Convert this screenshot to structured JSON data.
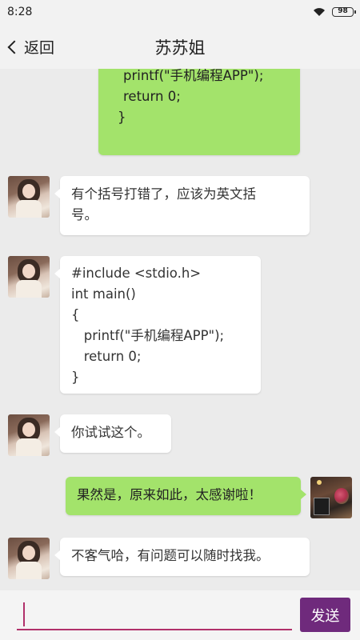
{
  "status_bar": {
    "time": "8:28",
    "battery": "98",
    "wifi_icon": "wifi-icon"
  },
  "header": {
    "back_label": "返回",
    "title": "苏苏姐"
  },
  "messages": [
    {
      "side": "right",
      "lines": [
        "printf(\"手机编程APP\");",
        "return 0;",
        "}"
      ]
    },
    {
      "side": "left",
      "lines": [
        "有个括号打错了，应该为英文括",
        "号。"
      ]
    },
    {
      "side": "left",
      "lines": [
        "#include <stdio.h>",
        "int main()",
        "{",
        "   printf(\"手机编程APP\");",
        "   return 0;",
        "}"
      ]
    },
    {
      "side": "left",
      "lines": [
        "你试试这个。"
      ]
    },
    {
      "side": "right",
      "lines": [
        "果然是，原来如此，太感谢啦！"
      ]
    },
    {
      "side": "left",
      "lines": [
        "不客气哈，有问题可以随时找我。"
      ]
    }
  ],
  "input": {
    "value": "",
    "send_label": "发送"
  },
  "colors": {
    "accent": "#6f2a7c",
    "green_bubble": "#a3e36b",
    "input_underline": "#b0306a"
  }
}
